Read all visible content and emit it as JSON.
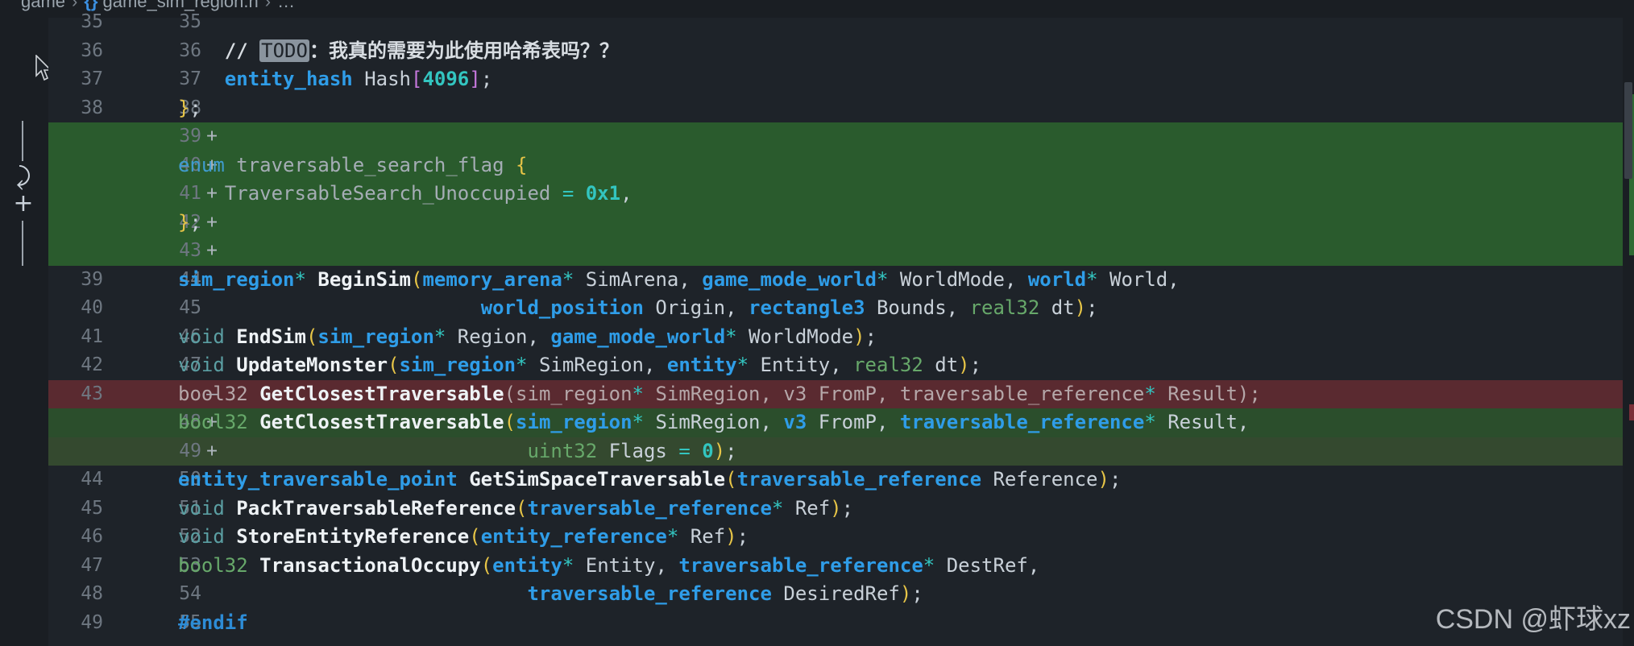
{
  "breadcrumb": {
    "items": [
      "game",
      "game_sim_region.h",
      "…"
    ],
    "header_icon": "{}"
  },
  "colors": {
    "added_bg": "#2a5b2d",
    "removed_bg": "#5a2a30",
    "keyword": "#2f9de8",
    "number": "#33c5c0",
    "paren": "#e7c547"
  },
  "gutter_tools": {
    "icons": [
      "revert-icon",
      "stage-hunk-icon"
    ],
    "revert_glyph": "⤸",
    "stage_glyph": "+"
  },
  "lines": [
    {
      "old": "35",
      "new": "35",
      "marker": "",
      "kind": "context",
      "tokens": []
    },
    {
      "old": "36",
      "new": "36",
      "marker": "",
      "kind": "context",
      "tokens": [
        {
          "t": "    ",
          "c": "t-id"
        },
        {
          "t": "// ",
          "c": "t-cmt"
        },
        {
          "t": "TODO",
          "c": "t-todo"
        },
        {
          "t": "：我真的需要为此使用哈希表吗？？",
          "c": "t-cmt"
        }
      ]
    },
    {
      "old": "37",
      "new": "37",
      "marker": "",
      "kind": "context",
      "tokens": [
        {
          "t": "    ",
          "c": "t-id"
        },
        {
          "t": "entity_hash",
          "c": "t-kw"
        },
        {
          "t": " Hash",
          "c": "t-id"
        },
        {
          "t": "[",
          "c": "t-bracket"
        },
        {
          "t": "4096",
          "c": "t-num"
        },
        {
          "t": "]",
          "c": "t-bracket"
        },
        {
          "t": ";",
          "c": "t-punc"
        }
      ]
    },
    {
      "old": "38",
      "new": "38",
      "marker": "",
      "kind": "context",
      "tokens": [
        {
          "t": "}",
          "c": "t-paren"
        },
        {
          "t": ";",
          "c": "t-punc"
        }
      ]
    },
    {
      "old": "",
      "new": "39",
      "marker": "+",
      "kind": "added",
      "tokens": []
    },
    {
      "old": "",
      "new": "40",
      "marker": "+",
      "kind": "added",
      "tokens": [
        {
          "t": "enum",
          "c": "t-enum"
        },
        {
          "t": " traversable_search_flag ",
          "c": "t-dim"
        },
        {
          "t": "{",
          "c": "t-paren"
        }
      ]
    },
    {
      "old": "",
      "new": "41",
      "marker": "+",
      "kind": "added",
      "tokens": [
        {
          "t": "    TraversableSearch_Unoccupied ",
          "c": "t-dim"
        },
        {
          "t": "=",
          "c": "t-op"
        },
        {
          "t": " ",
          "c": "t-id"
        },
        {
          "t": "0x1",
          "c": "t-num"
        },
        {
          "t": ",",
          "c": "t-punc"
        }
      ]
    },
    {
      "old": "",
      "new": "42",
      "marker": "+",
      "kind": "added",
      "tokens": [
        {
          "t": "}",
          "c": "t-paren"
        },
        {
          "t": ";",
          "c": "t-punc"
        }
      ]
    },
    {
      "old": "",
      "new": "43",
      "marker": "+",
      "kind": "added",
      "tokens": []
    },
    {
      "old": "39",
      "new": "44",
      "marker": "",
      "kind": "context",
      "tokens": [
        {
          "t": "sim_region",
          "c": "t-kw"
        },
        {
          "t": "*",
          "c": "t-op"
        },
        {
          "t": " ",
          "c": "t-id"
        },
        {
          "t": "BeginSim",
          "c": "t-fn"
        },
        {
          "t": "(",
          "c": "t-paren"
        },
        {
          "t": "memory_arena",
          "c": "t-kw"
        },
        {
          "t": "*",
          "c": "t-op"
        },
        {
          "t": " SimArena, ",
          "c": "t-id"
        },
        {
          "t": "game_mode_world",
          "c": "t-kw"
        },
        {
          "t": "*",
          "c": "t-op"
        },
        {
          "t": " WorldMode, ",
          "c": "t-id"
        },
        {
          "t": "world",
          "c": "t-kw"
        },
        {
          "t": "*",
          "c": "t-op"
        },
        {
          "t": " World,",
          "c": "t-id"
        }
      ]
    },
    {
      "old": "40",
      "new": "45",
      "marker": "",
      "kind": "context",
      "tokens": [
        {
          "t": "                          ",
          "c": "t-id"
        },
        {
          "t": "world_position",
          "c": "t-kw"
        },
        {
          "t": " Origin, ",
          "c": "t-id"
        },
        {
          "t": "rectangle3",
          "c": "t-kw"
        },
        {
          "t": " Bounds, ",
          "c": "t-id"
        },
        {
          "t": "real32",
          "c": "t-typeg"
        },
        {
          "t": " dt",
          "c": "t-id"
        },
        {
          "t": ")",
          "c": "t-paren"
        },
        {
          "t": ";",
          "c": "t-punc"
        }
      ]
    },
    {
      "old": "41",
      "new": "46",
      "marker": "",
      "kind": "context",
      "tokens": [
        {
          "t": "void",
          "c": "t-kwl"
        },
        {
          "t": " ",
          "c": "t-id"
        },
        {
          "t": "EndSim",
          "c": "t-fn"
        },
        {
          "t": "(",
          "c": "t-paren"
        },
        {
          "t": "sim_region",
          "c": "t-kw"
        },
        {
          "t": "*",
          "c": "t-op"
        },
        {
          "t": " Region, ",
          "c": "t-id"
        },
        {
          "t": "game_mode_world",
          "c": "t-kw"
        },
        {
          "t": "*",
          "c": "t-op"
        },
        {
          "t": " WorldMode",
          "c": "t-id"
        },
        {
          "t": ")",
          "c": "t-paren"
        },
        {
          "t": ";",
          "c": "t-punc"
        }
      ]
    },
    {
      "old": "42",
      "new": "47",
      "marker": "",
      "kind": "context",
      "tokens": [
        {
          "t": "void",
          "c": "t-kwl"
        },
        {
          "t": " ",
          "c": "t-id"
        },
        {
          "t": "UpdateMonster",
          "c": "t-fn"
        },
        {
          "t": "(",
          "c": "t-paren"
        },
        {
          "t": "sim_region",
          "c": "t-kw"
        },
        {
          "t": "*",
          "c": "t-op"
        },
        {
          "t": " SimRegion, ",
          "c": "t-id"
        },
        {
          "t": "entity",
          "c": "t-kw"
        },
        {
          "t": "*",
          "c": "t-op"
        },
        {
          "t": " Entity, ",
          "c": "t-id"
        },
        {
          "t": "real32",
          "c": "t-typeg"
        },
        {
          "t": " dt",
          "c": "t-id"
        },
        {
          "t": ")",
          "c": "t-paren"
        },
        {
          "t": ";",
          "c": "t-punc"
        }
      ]
    },
    {
      "old": "43",
      "new": "",
      "marker": "—",
      "kind": "removed",
      "tokens": [
        {
          "t": "bool32",
          "c": "t-type-removed"
        },
        {
          "t": " ",
          "c": "t-id"
        },
        {
          "t": "GetClosestTraversable",
          "c": "t-fn"
        },
        {
          "t": "(sim_region",
          "c": "t-type-removed"
        },
        {
          "t": "*",
          "c": "t-op"
        },
        {
          "t": " SimRegion, v3 FromP, traversable_reference",
          "c": "t-type-removed"
        },
        {
          "t": "*",
          "c": "t-op"
        },
        {
          "t": " Result);",
          "c": "t-type-removed"
        }
      ]
    },
    {
      "old": "",
      "new": "48",
      "marker": "+",
      "kind": "added-soft",
      "tokens": [
        {
          "t": "bool32",
          "c": "t-typeg"
        },
        {
          "t": " ",
          "c": "t-id"
        },
        {
          "t": "GetClosestTraversable",
          "c": "t-fn"
        },
        {
          "t": "(",
          "c": "t-paren"
        },
        {
          "t": "sim_region",
          "c": "t-kw"
        },
        {
          "t": "*",
          "c": "t-op"
        },
        {
          "t": " SimRegion, ",
          "c": "t-id"
        },
        {
          "t": "v3",
          "c": "t-kw"
        },
        {
          "t": " FromP, ",
          "c": "t-id"
        },
        {
          "t": "traversable_reference",
          "c": "t-kw"
        },
        {
          "t": "*",
          "c": "t-op"
        },
        {
          "t": " Result,",
          "c": "t-id"
        }
      ]
    },
    {
      "old": "",
      "new": "49",
      "marker": "+",
      "kind": "added-tail",
      "tokens": [
        {
          "t": "                              ",
          "c": "t-id"
        },
        {
          "t": "uint32",
          "c": "t-typeg"
        },
        {
          "t": " Flags ",
          "c": "t-id"
        },
        {
          "t": "=",
          "c": "t-op"
        },
        {
          "t": " ",
          "c": "t-id"
        },
        {
          "t": "0",
          "c": "t-num"
        },
        {
          "t": ")",
          "c": "t-paren"
        },
        {
          "t": ";",
          "c": "t-punc"
        }
      ]
    },
    {
      "old": "44",
      "new": "50",
      "marker": "",
      "kind": "context",
      "tokens": [
        {
          "t": "entity_traversable_point",
          "c": "t-kw"
        },
        {
          "t": " ",
          "c": "t-id"
        },
        {
          "t": "GetSimSpaceTraversable",
          "c": "t-fn"
        },
        {
          "t": "(",
          "c": "t-paren"
        },
        {
          "t": "traversable_reference",
          "c": "t-kw"
        },
        {
          "t": " Reference",
          "c": "t-id"
        },
        {
          "t": ")",
          "c": "t-paren"
        },
        {
          "t": ";",
          "c": "t-punc"
        }
      ]
    },
    {
      "old": "45",
      "new": "51",
      "marker": "",
      "kind": "context",
      "tokens": [
        {
          "t": "void",
          "c": "t-kwl"
        },
        {
          "t": " ",
          "c": "t-id"
        },
        {
          "t": "PackTraversableReference",
          "c": "t-fn"
        },
        {
          "t": "(",
          "c": "t-paren"
        },
        {
          "t": "traversable_reference",
          "c": "t-kw"
        },
        {
          "t": "*",
          "c": "t-op"
        },
        {
          "t": " Ref",
          "c": "t-id"
        },
        {
          "t": ")",
          "c": "t-paren"
        },
        {
          "t": ";",
          "c": "t-punc"
        }
      ]
    },
    {
      "old": "46",
      "new": "52",
      "marker": "",
      "kind": "context",
      "tokens": [
        {
          "t": "void",
          "c": "t-kwl"
        },
        {
          "t": " ",
          "c": "t-id"
        },
        {
          "t": "StoreEntityReference",
          "c": "t-fn"
        },
        {
          "t": "(",
          "c": "t-paren"
        },
        {
          "t": "entity_reference",
          "c": "t-kw"
        },
        {
          "t": "*",
          "c": "t-op"
        },
        {
          "t": " Ref",
          "c": "t-id"
        },
        {
          "t": ")",
          "c": "t-paren"
        },
        {
          "t": ";",
          "c": "t-punc"
        }
      ]
    },
    {
      "old": "47",
      "new": "53",
      "marker": "",
      "kind": "context",
      "tokens": [
        {
          "t": "bool32",
          "c": "t-typeg"
        },
        {
          "t": " ",
          "c": "t-id"
        },
        {
          "t": "TransactionalOccupy",
          "c": "t-fn"
        },
        {
          "t": "(",
          "c": "t-paren"
        },
        {
          "t": "entity",
          "c": "t-kw"
        },
        {
          "t": "*",
          "c": "t-op"
        },
        {
          "t": " Entity, ",
          "c": "t-id"
        },
        {
          "t": "traversable_reference",
          "c": "t-kw"
        },
        {
          "t": "*",
          "c": "t-op"
        },
        {
          "t": " DestRef,",
          "c": "t-id"
        }
      ]
    },
    {
      "old": "48",
      "new": "54",
      "marker": "",
      "kind": "context",
      "tokens": [
        {
          "t": "                              ",
          "c": "t-id"
        },
        {
          "t": "traversable_reference",
          "c": "t-kw"
        },
        {
          "t": " DesiredRef",
          "c": "t-id"
        },
        {
          "t": ")",
          "c": "t-paren"
        },
        {
          "t": ";",
          "c": "t-punc"
        }
      ]
    },
    {
      "old": "49",
      "new": "55",
      "marker": "",
      "kind": "context",
      "tokens": [
        {
          "t": "#endif",
          "c": "t-pre"
        }
      ]
    }
  ],
  "watermark": "CSDN @虾球xz"
}
